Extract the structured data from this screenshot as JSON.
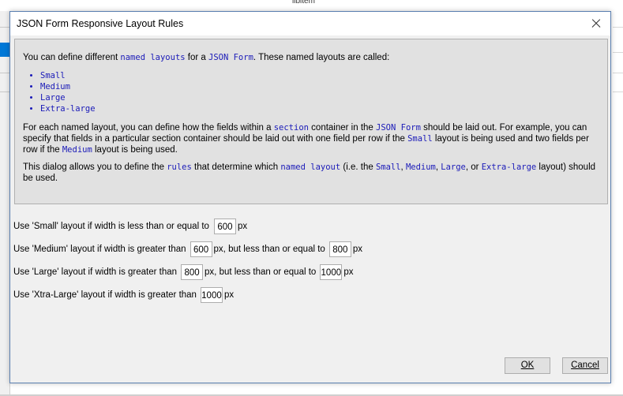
{
  "background": {
    "top_text": "libitem"
  },
  "dialog": {
    "title": "JSON Form Responsive Layout Rules",
    "info": {
      "p1_pre": "You can define different ",
      "p1_code1": "named layouts",
      "p1_mid": " for a ",
      "p1_code2": "JSON Form",
      "p1_post": ". These named layouts are called:",
      "layouts": [
        "Small",
        "Medium",
        "Large",
        "Extra-large"
      ],
      "p2_a": "For each named layout, you can define how the fields within a ",
      "p2_code1": "section",
      "p2_b": " container in the ",
      "p2_code2": "JSON Form",
      "p2_c": " should be laid out. For example, you can specify that fields in a particular section container should be laid out with one field per row if the ",
      "p2_code3": "Small",
      "p2_d": " layout is being used and two fields per row if the ",
      "p2_code4": "Medium",
      "p2_e": " layout is being used.",
      "p3_a": "This dialog allows you to define the ",
      "p3_code1": "rules",
      "p3_b": " that determine which ",
      "p3_code2": "named layout",
      "p3_c": " (i.e. the ",
      "p3_code3": "Small",
      "p3_sep1": ", ",
      "p3_code4": "Medium",
      "p3_sep2": ", ",
      "p3_code5": "Large",
      "p3_sep3": ", or ",
      "p3_code6": "Extra-large",
      "p3_d": " layout) should be used."
    },
    "rules": {
      "small_label": "Use 'Small' layout if width is less than or equal to",
      "small_value": "600",
      "medium_label": "Use 'Medium' layout if width is greater than",
      "medium_min": "600",
      "medium_mid": "px, but less than or equal to",
      "medium_max": "800",
      "large_label": "Use 'Large' layout if width is greater than",
      "large_min": "800",
      "large_mid": "px, but less than or equal to",
      "large_max": "1000",
      "xl_label": "Use 'Xtra-Large' layout if width is greater than",
      "xl_value": "1000",
      "unit": "px"
    },
    "buttons": {
      "ok": "OK",
      "cancel": "Cancel"
    }
  }
}
